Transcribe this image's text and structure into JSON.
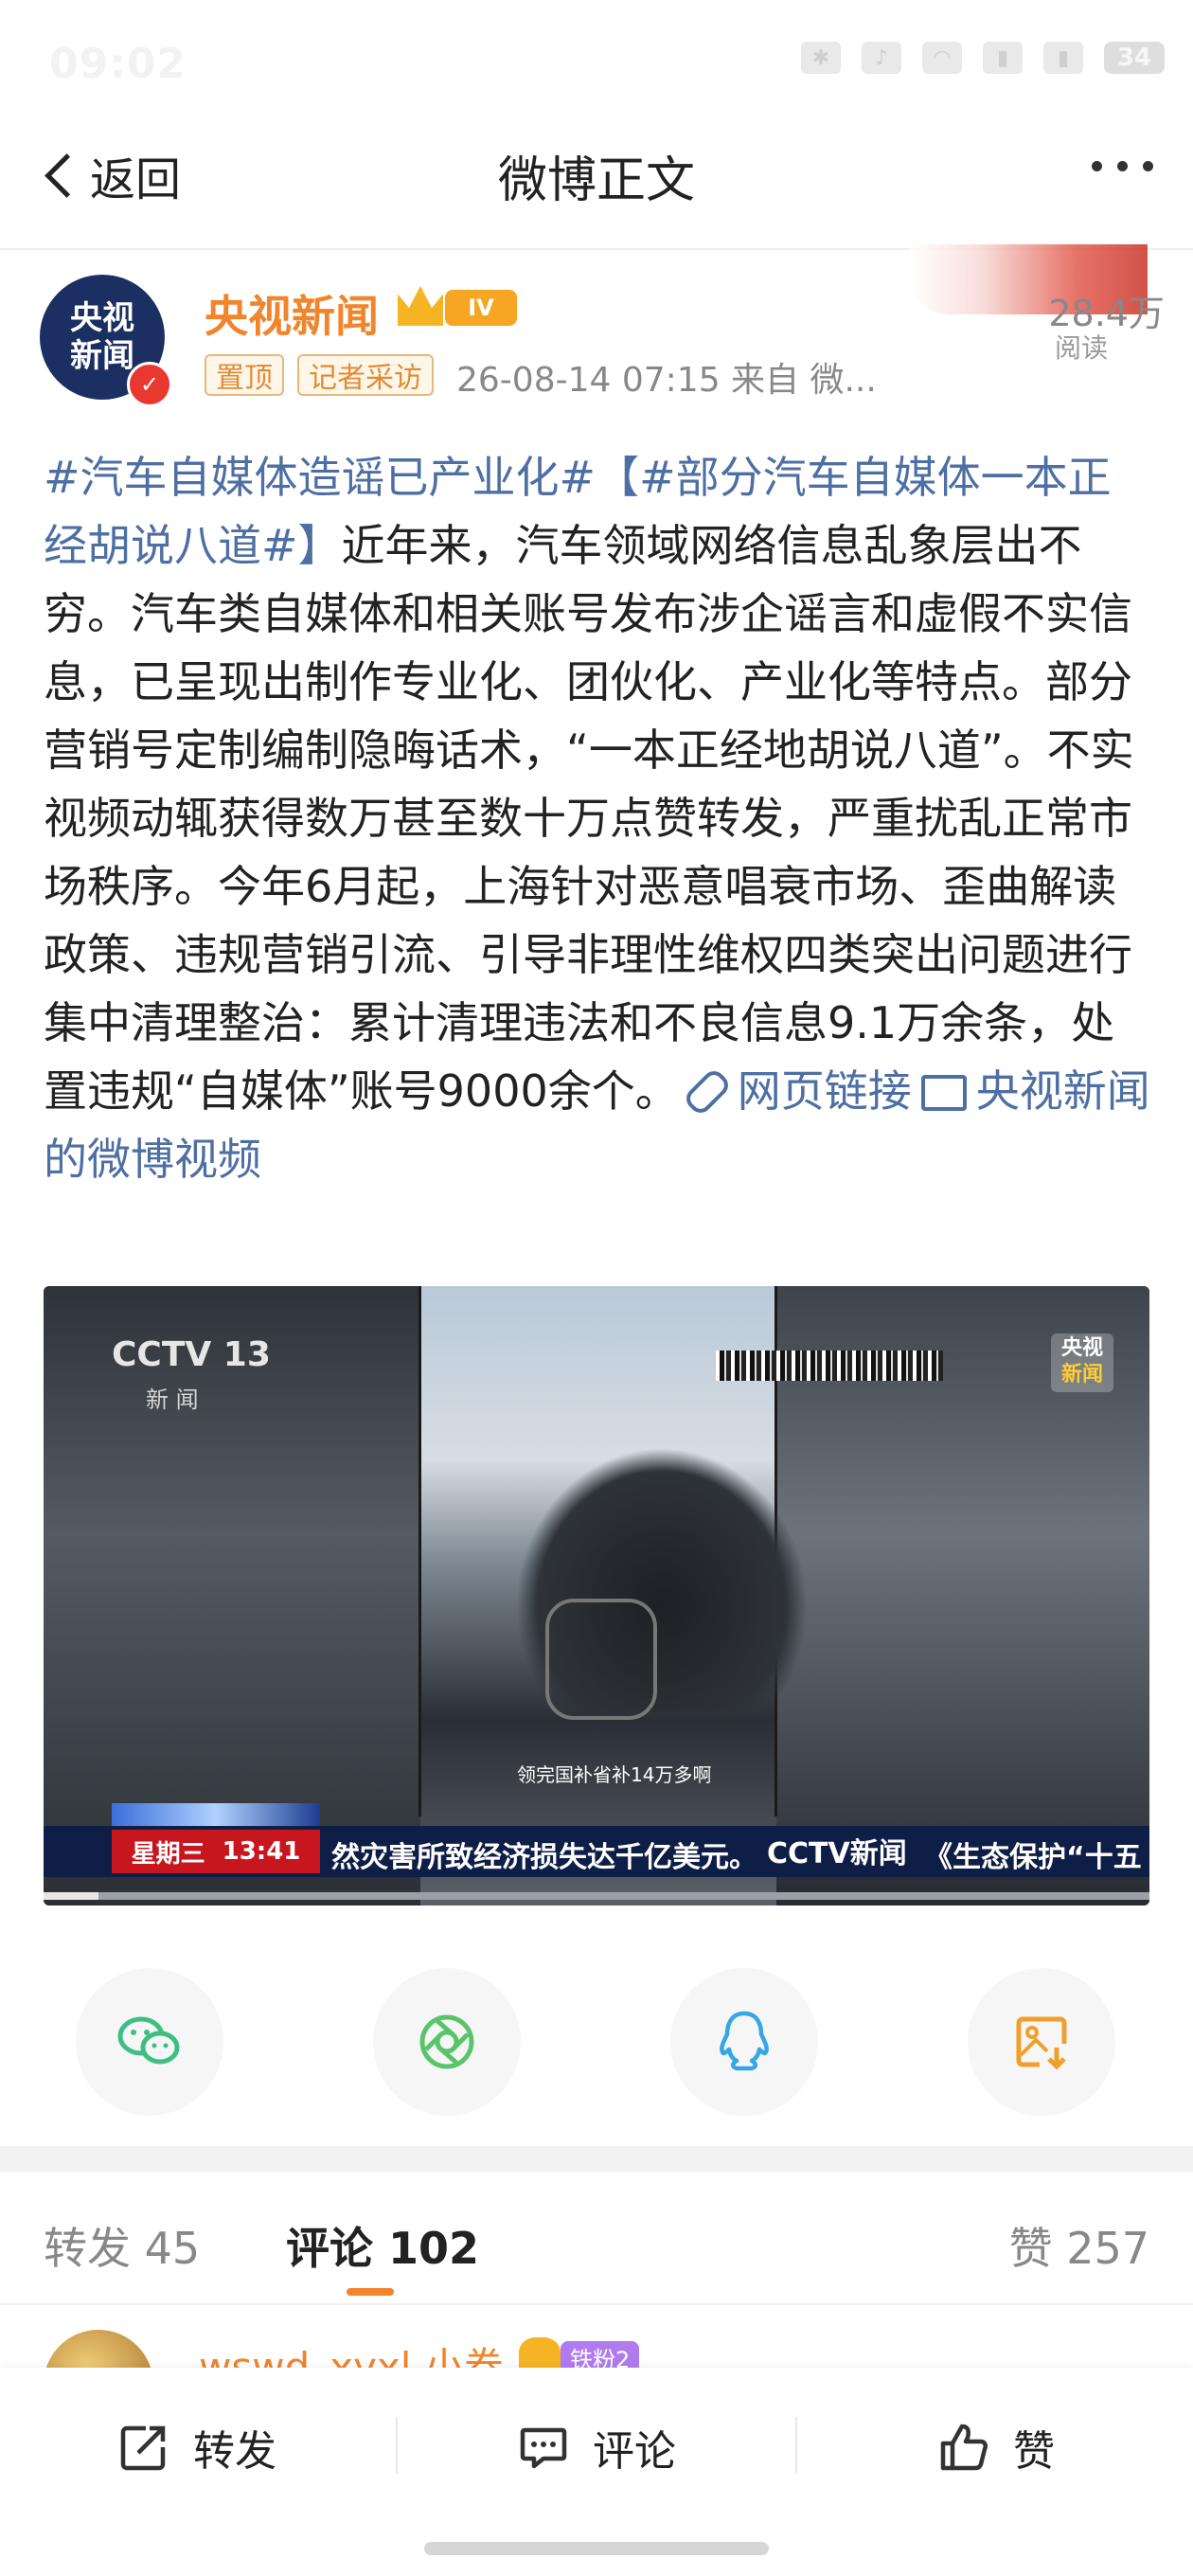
{
  "status_bar": {
    "time": "09:02",
    "battery": "34"
  },
  "nav": {
    "back_label": "返回",
    "title": "微博正文"
  },
  "post": {
    "author": "央视新闻",
    "avatar_text_line1": "央视",
    "avatar_text_line2": "新闻",
    "level_badge": "IV",
    "tags": [
      "置顶",
      "记者采访"
    ],
    "meta": "26-08-14 07:15  来自 微...",
    "read_count": "28.4万",
    "read_label": "阅读",
    "hashtag1": "#汽车自媒体造谣已产业化#",
    "hashtag2": "【#部分汽车自媒体一本正经胡说八道#】",
    "body": "近年来，汽车领域网络信息乱象层出不穷。汽车类自媒体和相关账号发布涉企谣言和虚假不实信息，已呈现出制作专业化、团伙化、产业化等特点。部分营销号定制编制隐晦话术，“一本正经地胡说八道”。不实视频动辄获得数万甚至数十万点赞转发，严重扰乱正常市场秩序。今年6月起，上海针对恶意唱衰市场、歪曲解读政策、违规营销引流、引导非理性维权四类突出问题进行集中清理整治：累计清理违法和不良信息9.1万余条，处置违规“自媒体”账号9000余个。",
    "link_label": "网页链接",
    "video_link_label": "央视新闻的微博视频"
  },
  "video": {
    "channel_logo": "CCTV 13",
    "channel_sub": "新  闻",
    "corner_logo_line1": "央视",
    "corner_logo_line2": "新闻",
    "subtitle": "领完国补省补14万多啊",
    "ticker_day": "星期三",
    "ticker_time": "13:41",
    "ticker_text": "然灾害所致经济损失达千亿美元。",
    "ticker_logo": "CCTV新闻",
    "ticker_text2": "《生态保护“十五",
    "progress": 0.05
  },
  "share": [
    "wechat-icon",
    "moments-icon",
    "qq-icon",
    "save-image-icon"
  ],
  "tabs": {
    "repost": "转发 45",
    "comment": "评论 102",
    "like": "赞 257"
  },
  "comment_preview": {
    "name": "wswd_xyxl 小卷",
    "badge": "铁粉2"
  },
  "bottom_bar": {
    "repost": "转发",
    "comment": "评论",
    "like": "赞"
  },
  "colors": {
    "accent": "#f5832a",
    "link": "#4e6fa3",
    "author": "#f0852c"
  }
}
